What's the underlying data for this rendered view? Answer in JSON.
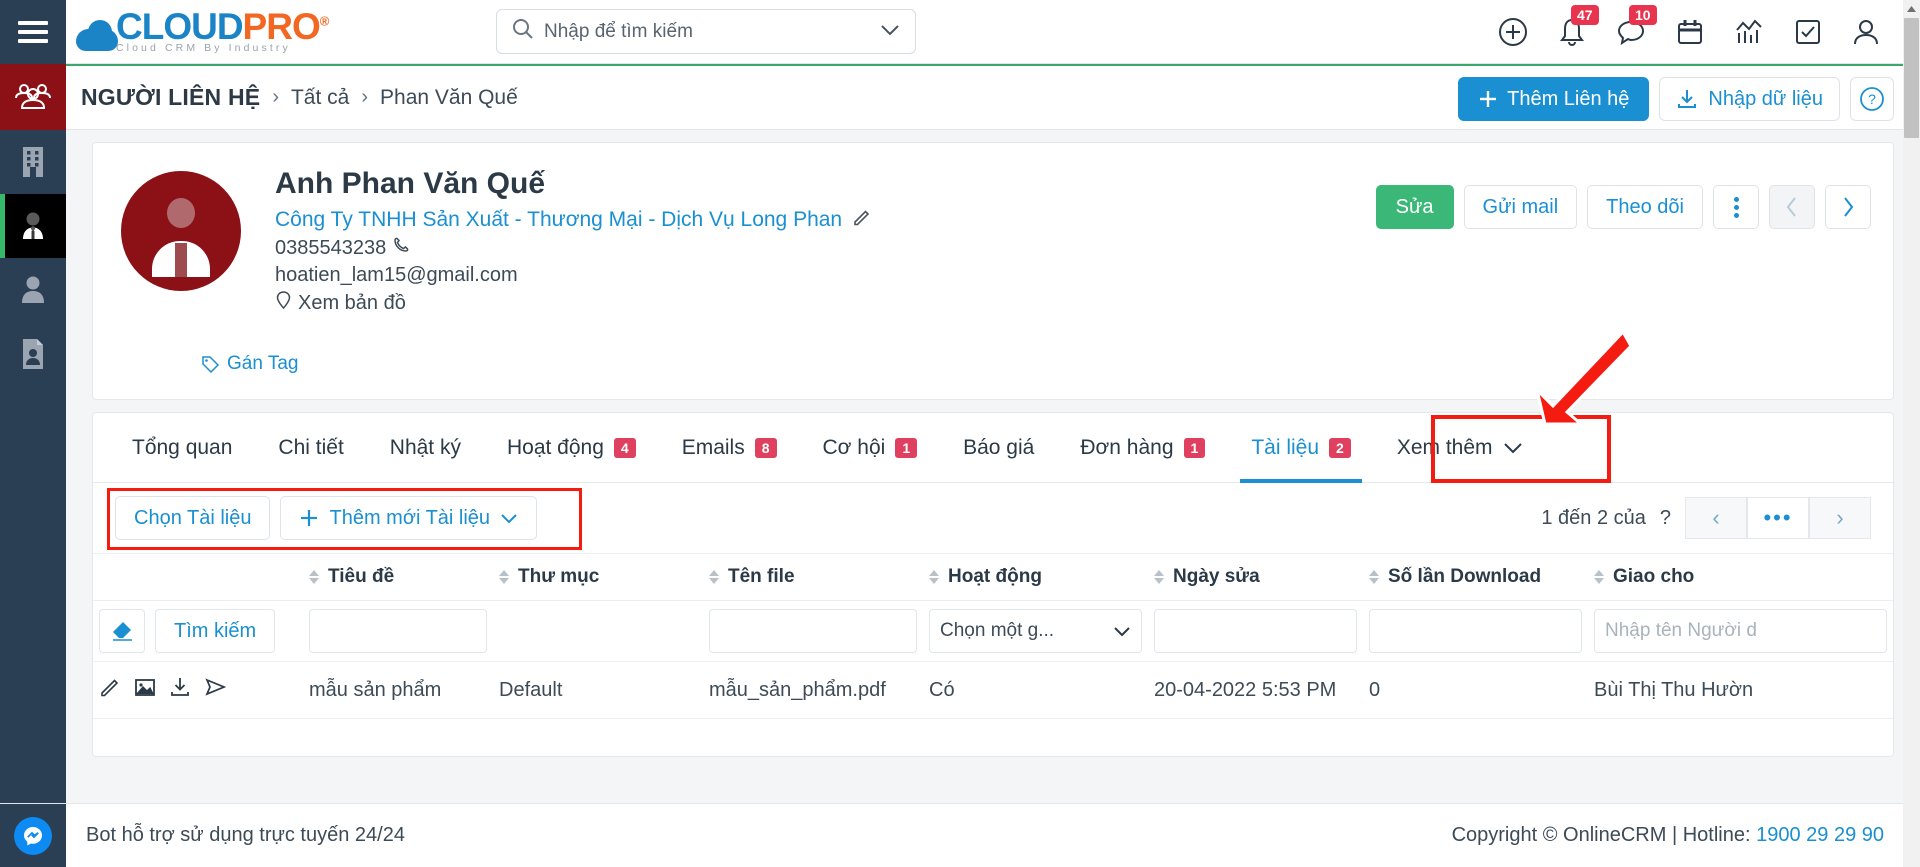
{
  "header": {
    "logo": {
      "primary": "CLOUD",
      "secondary": "PRO",
      "reg": "®",
      "tagline": "Cloud CRM By Industry"
    },
    "search": {
      "placeholder": "Nhập để tìm kiếm"
    },
    "icons": [
      {
        "name": "add-circle-icon",
        "badge": ""
      },
      {
        "name": "bell-icon",
        "badge": "47"
      },
      {
        "name": "chat-icon",
        "badge": "10"
      },
      {
        "name": "calendar-icon",
        "badge": ""
      },
      {
        "name": "analytics-icon",
        "badge": ""
      },
      {
        "name": "task-checkbox-icon",
        "badge": ""
      },
      {
        "name": "user-account-icon",
        "badge": ""
      }
    ]
  },
  "breadcrumb": {
    "module": "NGƯỜI LIÊN HỆ",
    "sep": "›",
    "all": "Tất cả",
    "current": "Phan Văn Quế"
  },
  "crumb_actions": {
    "add_label": "Thêm Liên hệ",
    "import_label": "Nhập dữ liệu",
    "help_label": "?"
  },
  "contact": {
    "name": "Anh Phan Văn Quế",
    "company": "Công Ty TNHH Sản Xuất - Thương Mại - Dịch Vụ Long Phan",
    "phone": "0385543238",
    "email": "hoatien_lam15@gmail.com",
    "map_label": "Xem bản đồ",
    "tag_label": "Gán Tag",
    "actions": {
      "edit": "Sửa",
      "send_mail": "Gửi mail",
      "follow": "Theo dõi"
    }
  },
  "tabs": [
    {
      "label": "Tổng quan",
      "badge": "",
      "active": false
    },
    {
      "label": "Chi tiết",
      "badge": "",
      "active": false
    },
    {
      "label": "Nhật ký",
      "badge": "",
      "active": false
    },
    {
      "label": "Hoạt động",
      "badge": "4",
      "active": false
    },
    {
      "label": "Emails",
      "badge": "8",
      "active": false
    },
    {
      "label": "Cơ hội",
      "badge": "1",
      "active": false
    },
    {
      "label": "Báo giá",
      "badge": "",
      "active": false
    },
    {
      "label": "Đơn hàng",
      "badge": "1",
      "active": false
    },
    {
      "label": "Tài liệu",
      "badge": "2",
      "active": true
    },
    {
      "label": "Xem thêm",
      "badge": "",
      "active": false
    }
  ],
  "toolbar": {
    "select_doc_label": "Chọn Tài liệu",
    "add_doc_label": "Thêm mới Tài liệu"
  },
  "pagination": {
    "range_text": "1 đến 2 của",
    "total_unknown": "?",
    "prev": "‹",
    "more": "•••",
    "next": "›"
  },
  "table": {
    "columns": [
      "Tiêu đề",
      "Thư mục",
      "Tên file",
      "Hoạt động",
      "Ngày sửa",
      "Số lần Download",
      "Giao cho"
    ],
    "filters": {
      "clear_label": "",
      "search_label": "Tìm kiếm",
      "title_value": "",
      "folder_value": "",
      "filename_value": "",
      "activity_value": "Chọn một g...",
      "date_value": "",
      "downloads_value": "",
      "assigned_placeholder": "Nhập tên Người d"
    },
    "rows": [
      {
        "title": "mẫu sản phẩm",
        "folder": "Default",
        "filename": "mẫu_sản_phẩm.pdf",
        "activity": "Có",
        "modified": "20-04-2022 5:53 PM",
        "downloads": "0",
        "assigned": "Bùi Thị Thu Hườn"
      }
    ]
  },
  "footer": {
    "support_text": "Bot hỗ trợ sử dụng trực tuyến 24/24",
    "copyright": "Copyright © OnlineCRM",
    "divider": "|",
    "hotline_label": "Hotline:",
    "hotline_number": "1900 29 29 90"
  },
  "colors": {
    "brand_blue": "#1a8fd1",
    "brand_orange": "#f26722",
    "accent_green": "#3bb878",
    "sidebar": "#2b3f54",
    "sidebar_head": "#8c1117",
    "badge_red": "#e0405f",
    "annotation_red": "#f41b11"
  }
}
